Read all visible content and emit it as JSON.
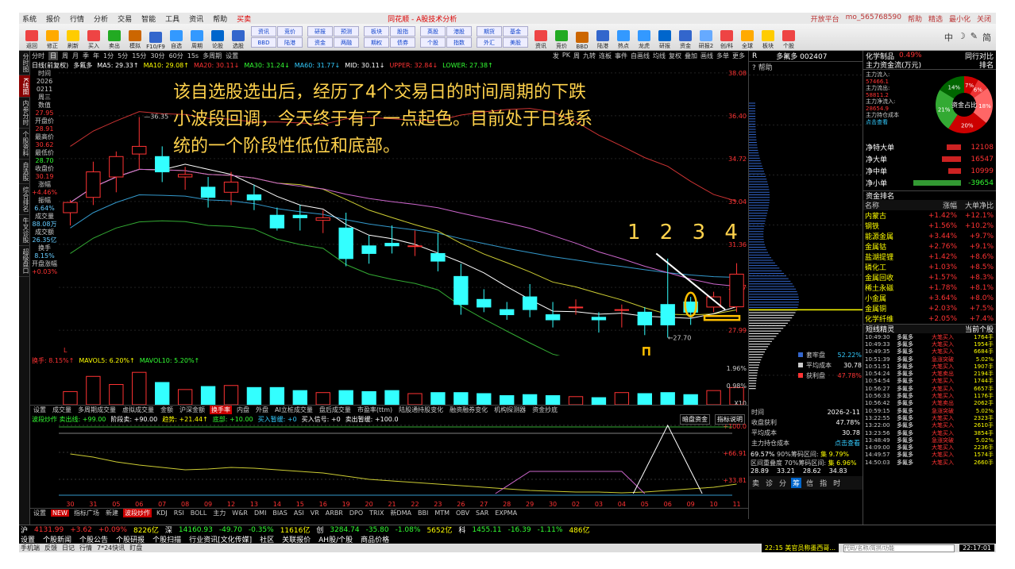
{
  "menubar": {
    "items": [
      "系统",
      "报价",
      "行情",
      "分析",
      "交易",
      "智能",
      "工具",
      "资讯",
      "帮助",
      "买卖"
    ],
    "center": "同花顺 - A股技术分析",
    "right": [
      "开放平台",
      "mo_565768590",
      "帮助",
      "精选",
      "最小化",
      "关闭"
    ]
  },
  "toolbar": {
    "buttons": [
      "返回",
      "修正",
      "刷新",
      "买入",
      "卖出",
      "模拟",
      "F10/F9",
      "自选",
      "周期",
      "论股",
      "选股",
      "资讯",
      "竞价",
      "BBD",
      "陆港",
      "热点",
      "龙虎",
      "研报",
      "资金",
      "研报2",
      "创/科",
      "全球",
      "板块",
      "个股",
      "股指",
      "指数",
      "期权",
      "期货",
      "债券",
      "基金",
      "英股",
      "外汇",
      "港股",
      "美股",
      "自定",
      "步窗",
      "默认"
    ],
    "smalls": [
      "资讯",
      "竞价",
      "BBD",
      "陆港",
      "研报",
      "预测",
      "资金",
      "两融",
      "板块",
      "股指",
      "期权",
      "债券",
      "英股",
      "港股",
      "个股",
      "指数",
      "期货",
      "基金",
      "外汇",
      "美股"
    ],
    "right": [
      "中",
      "☽",
      "✎",
      "简"
    ]
  },
  "lefttabs": [
    "分时图",
    "K线图",
    "内参分时",
    "个股资料",
    "自选股",
    "综合排名",
    "牛叉诊股",
    "超级盘口"
  ],
  "period": {
    "items": [
      "分时",
      "日",
      "周",
      "月",
      "季",
      "年",
      "1分",
      "5分",
      "15分",
      "30分",
      "60分",
      "15s",
      "多周期",
      "设置"
    ],
    "active": "日",
    "right": [
      "发",
      "PK",
      "周",
      "九转",
      "连板",
      "事件",
      "自画线",
      "均线",
      "复权",
      "叠加",
      "画线",
      "多单",
      "更多"
    ]
  },
  "info": {
    "stock": "多氟多",
    "items": [
      {
        "t": "日线(前复权)",
        "c": "w"
      },
      {
        "t": "MA5: 29.33↑",
        "c": "w"
      },
      {
        "t": "MA10: 29.08↑",
        "c": "y"
      },
      {
        "t": "MA20: 30.11↓",
        "c": "r"
      },
      {
        "t": "MA30: 31.24↓",
        "c": "g"
      },
      {
        "t": "MA60: 31.77↓",
        "c": "cy"
      },
      {
        "t": "MID: 30.11↓",
        "c": "w"
      },
      {
        "t": "UPPER: 32.84↓",
        "c": "r"
      },
      {
        "t": "LOWER: 27.38↑",
        "c": "g"
      }
    ]
  },
  "leftdata": [
    {
      "k": "时间",
      "v": "",
      "c": ""
    },
    {
      "k": "2026",
      "v": "",
      "c": ""
    },
    {
      "k": "0211",
      "v": "",
      "c": ""
    },
    {
      "k": "周三",
      "v": "",
      "c": ""
    },
    {
      "k": "数值",
      "v": "27.95",
      "c": "v"
    },
    {
      "k": "开盘价",
      "v": "28.91",
      "c": "v"
    },
    {
      "k": "最高价",
      "v": "30.62",
      "c": "v"
    },
    {
      "k": "最低价",
      "v": "28.70",
      "c": "g"
    },
    {
      "k": "收盘价",
      "v": "30.19",
      "c": "v"
    },
    {
      "k": "涨幅",
      "v": "+4.46%",
      "c": "v"
    },
    {
      "k": "振幅",
      "v": "6.64%",
      "c": "c"
    },
    {
      "k": "成交量",
      "v": "88.08万",
      "c": "c"
    },
    {
      "k": "成交额",
      "v": "26.35亿",
      "c": "c"
    },
    {
      "k": "换手",
      "v": "8.15%",
      "c": "c"
    },
    {
      "k": "开盘涨幅",
      "v": "+0.03%",
      "c": "v"
    }
  ],
  "annotation": "该自选股选出后，经历了4个交易日的时间周期的下跌小波段回调，今天终于有了一点起色。目前处于日线系统的一个阶段性低位和底部。",
  "numbers": "1 2 3 4",
  "chart_data": {
    "type": "candlestick",
    "x": [
      "30",
      "31",
      "05",
      "06",
      "07",
      "08",
      "09",
      "12",
      "13",
      "14",
      "15",
      "16",
      "19",
      "20",
      "21",
      "22",
      "23",
      "26",
      "27",
      "28",
      "29",
      "30",
      "02",
      "03",
      "04",
      "05",
      "06",
      "09",
      "10",
      "11"
    ],
    "ohlc": [
      [
        32.6,
        33.1,
        32.1,
        33.0
      ],
      [
        33.2,
        34.6,
        32.9,
        34.2
      ],
      [
        34.0,
        35.0,
        33.4,
        34.8
      ],
      [
        34.9,
        36.35,
        34.3,
        35.2
      ],
      [
        34.8,
        35.2,
        33.8,
        34.2
      ],
      [
        34.0,
        34.4,
        33.5,
        34.1
      ],
      [
        33.6,
        34.0,
        32.8,
        33.2
      ],
      [
        33.4,
        34.2,
        32.9,
        33.8
      ],
      [
        33.3,
        33.7,
        32.7,
        33.1
      ],
      [
        32.5,
        32.8,
        31.9,
        32.0
      ],
      [
        32.5,
        32.9,
        31.9,
        32.4
      ],
      [
        32.3,
        32.7,
        31.8,
        32.4
      ],
      [
        32.0,
        32.6,
        30.5,
        30.8
      ],
      [
        31.3,
        31.7,
        30.6,
        31.0
      ],
      [
        31.4,
        32.1,
        31.0,
        31.3
      ],
      [
        31.3,
        31.9,
        30.9,
        31.3
      ],
      [
        31.0,
        31.8,
        30.3,
        30.7
      ],
      [
        30.1,
        30.6,
        28.6,
        29.0
      ],
      [
        29.2,
        29.6,
        28.7,
        28.9
      ],
      [
        28.8,
        29.1,
        28.4,
        28.6
      ],
      [
        29.3,
        29.8,
        28.5,
        28.8
      ],
      [
        28.6,
        29.1,
        28.1,
        28.4
      ],
      [
        28.9,
        29.2,
        28.6,
        28.9
      ],
      [
        28.5,
        28.7,
        27.9,
        28.4
      ],
      [
        28.8,
        29.0,
        28.1,
        28.8
      ],
      [
        28.7,
        28.9,
        27.8,
        28.2
      ],
      [
        29.0,
        30.8,
        27.7,
        28.2
      ],
      [
        29.1,
        29.3,
        28.2,
        28.7
      ],
      [
        28.9,
        29.5,
        28.7,
        29.3
      ],
      [
        28.91,
        30.62,
        28.7,
        30.19
      ]
    ],
    "ylim": [
      27.0,
      38.2
    ],
    "yticks": [
      "38.08",
      "36.40",
      "34.72",
      "33.04",
      "31.36",
      "29.67",
      "27.99"
    ],
    "annotations": [
      "36.35",
      "27.70"
    ],
    "volume": [
      0.65,
      1.4,
      1.0,
      1.6,
      1.1,
      0.75,
      0.9,
      0.95,
      0.85,
      0.85,
      0.7,
      0.6,
      0.7,
      0.65,
      0.7,
      0.55,
      0.6,
      0.6,
      0.55,
      0.45,
      0.5,
      0.45,
      0.4,
      0.35,
      0.6,
      0.55,
      0.6,
      0.5,
      0.7,
      0.85
    ],
    "volticks": [
      "1.96%",
      "0.98%",
      "X10"
    ],
    "osc_ticks": [
      "+100.0",
      "+66.91",
      "+33.81"
    ]
  },
  "volinfo": [
    {
      "t": "换手: 8.15%↑",
      "c": "r"
    },
    {
      "t": "MAVOL5: 6.20%↑",
      "c": "y"
    },
    {
      "t": "MAVOL10: 5.20%↑",
      "c": "g"
    }
  ],
  "indtabs": [
    "设置",
    "成交量",
    "多周期成交量",
    "虚拟成交量",
    "金额",
    "沪深金额",
    "换手率",
    "内盘",
    "外盘",
    "AI立桩成交量",
    "盘后成交量",
    "市盈率(ttm)",
    "陆股通持股变化",
    "融资融券变化",
    "机构探测器",
    "资金抄底"
  ],
  "indactive": "换手率",
  "oscinfo": [
    {
      "t": "波段炒作 卖出线: +99.00",
      "c": "g"
    },
    {
      "t": "阶段卖: +90.00",
      "c": "w"
    },
    {
      "t": "趋势: +21.44↑",
      "c": "y"
    },
    {
      "t": "底部: +10.00",
      "c": "g"
    },
    {
      "t": "买入暂缓: +0",
      "c": "cy"
    },
    {
      "t": "买入信号: +0",
      "c": "w"
    },
    {
      "t": "卖出暂缓: +100.0",
      "c": "w"
    }
  ],
  "oscright": [
    "暗盘资金",
    "指标说明"
  ],
  "indtabs2": [
    "设置",
    "NEW",
    "指标广场",
    "新建",
    "波段炒作",
    "KDJ",
    "RSI",
    "BOLL",
    "主力",
    "W&R",
    "DMI",
    "BIAS",
    "ASI",
    "VR",
    "ARBR",
    "DPO",
    "TRIX",
    "新DMA",
    "BBI",
    "MTM",
    "OBV",
    "SAR",
    "EXPMA"
  ],
  "ind2active": "波段炒作",
  "mid": {
    "tabs": [
      "R",
      "多氟多 002407"
    ],
    "help": "帮助",
    "priceticks": [
      "38.08",
      "36.40",
      "34.72",
      "33.04",
      "31.36",
      "29.67",
      "27.99"
    ],
    "legend": [
      {
        "t": "套牢盘",
        "v": "52.22%",
        "c": "cy"
      },
      {
        "t": "平均成本",
        "v": "30.78",
        "c": "w"
      },
      {
        "t": "获利盘",
        "v": "47.78%",
        "c": "r"
      }
    ],
    "rows": [
      {
        "k": "时间",
        "v": "2026-2-11"
      },
      {
        "k": "收盘获利",
        "v": "47.78%"
      },
      {
        "k": "平均成本",
        "v": "30.78"
      },
      {
        "k": "主力持仓成本",
        "v": "点击查看"
      }
    ],
    "bottom": [
      "69.57%",
      "90%筹码区间:",
      "集 9.79%",
      "区间重叠度",
      "70%筹码区间:",
      "集 6.96%"
    ],
    "bottomnums": [
      "28.89",
      "33.21",
      "28.62",
      "34.83"
    ],
    "tabs2": [
      "卖",
      "诊",
      "分",
      "筹",
      "信",
      "指",
      "时"
    ]
  },
  "right": {
    "title": "化学制品",
    "pct": "0.49%",
    "title2": "同行对比",
    "flowtitle": "主力资金流(万元)",
    "rank": "排名",
    "pie": [
      "7%",
      "6%",
      "18%",
      "20%",
      "21%",
      "14%"
    ],
    "pielabel": "资金占比",
    "flow": [
      {
        "k": "主力流入:",
        "v": "57466.1"
      },
      {
        "k": "主力流出:",
        "v": "58811.2"
      },
      {
        "k": "主力净流入:",
        "v": "28654.9"
      },
      {
        "k": "主力持仓成本",
        "v": "点击查看"
      }
    ],
    "net": [
      {
        "k": "净特大单",
        "v": "12108",
        "c": "r",
        "w": 18
      },
      {
        "k": "净大单",
        "v": "16547",
        "c": "r",
        "w": 24
      },
      {
        "k": "净中单",
        "v": "10999",
        "c": "r",
        "w": 16
      },
      {
        "k": "净小单",
        "v": "-39654",
        "c": "g",
        "w": 60
      }
    ],
    "ranktitle": "资金排名",
    "rankhead": [
      "名称",
      "涨幅",
      "大单净比"
    ],
    "ranks": [
      {
        "n": "内蒙古",
        "a": "+1.42%",
        "b": "+12.1%"
      },
      {
        "n": "钢铁",
        "a": "+1.56%",
        "b": "+10.2%"
      },
      {
        "n": "能源金属",
        "a": "+3.44%",
        "b": "+9.7%"
      },
      {
        "n": "金属钴",
        "a": "+2.76%",
        "b": "+9.1%"
      },
      {
        "n": "盐湖提锂",
        "a": "+1.42%",
        "b": "+8.6%"
      },
      {
        "n": "磷化工",
        "a": "+1.03%",
        "b": "+8.5%"
      },
      {
        "n": "金属回收",
        "a": "+1.57%",
        "b": "+8.3%"
      },
      {
        "n": "稀土永磁",
        "a": "+1.78%",
        "b": "+8.1%"
      },
      {
        "n": "小金属",
        "a": "+3.64%",
        "b": "+8.0%"
      },
      {
        "n": "金属铜",
        "a": "+2.03%",
        "b": "+7.5%"
      },
      {
        "n": "化学纤维",
        "a": "+2.05%",
        "b": "+7.4%"
      }
    ],
    "tracktitle": "短线精灵",
    "track2": "当前个股",
    "trades": [
      [
        "10:49:30",
        "多氟多",
        "大笔买入",
        "1764手"
      ],
      [
        "10:49:33",
        "多氟多",
        "大笔买入",
        "1954手"
      ],
      [
        "10:49:35",
        "多氟多",
        "大笔买入",
        "6684手"
      ],
      [
        "10:51:39",
        "多氟多",
        "急涨突破",
        "5.02%"
      ],
      [
        "10:51:51",
        "多氟多",
        "大笔买入",
        "1907手"
      ],
      [
        "10:54:24",
        "多氟多",
        "大笔卖出",
        "2194手"
      ],
      [
        "10:54:54",
        "多氟多",
        "大笔买入",
        "1744手"
      ],
      [
        "10:56:27",
        "多氟多",
        "大笔买入",
        "6657手"
      ],
      [
        "10:56:33",
        "多氟多",
        "大笔买入",
        "1176手"
      ],
      [
        "10:56:42",
        "多氟多",
        "大笔卖出",
        "2062手"
      ],
      [
        "10:59:15",
        "多氟多",
        "急涨突破",
        "5.02%"
      ],
      [
        "13:22:55",
        "多氟多",
        "大笔买入",
        "2323手"
      ],
      [
        "13:22:00",
        "多氟多",
        "大笔买入",
        "2610手"
      ],
      [
        "13:23:56",
        "多氟多",
        "大笔买入",
        "3854手"
      ],
      [
        "13:48:49",
        "多氟多",
        "急涨突破",
        "5.02%"
      ],
      [
        "14:09:00",
        "多氟多",
        "大笔买入",
        "2236手"
      ],
      [
        "14:49:57",
        "多氟多",
        "大笔买入",
        "1574手"
      ],
      [
        "14:50:03",
        "多氟多",
        "大笔买入",
        "2660手"
      ]
    ]
  },
  "status": [
    {
      "t": "沪",
      "c": "w"
    },
    {
      "t": "4131.99",
      "c": "r"
    },
    {
      "t": "+3.62",
      "c": "r"
    },
    {
      "t": "+0.09%",
      "c": "r"
    },
    {
      "t": "8226亿",
      "c": "y"
    },
    {
      "t": "深",
      "c": "w"
    },
    {
      "t": "14160.93",
      "c": "g"
    },
    {
      "t": "-49.70",
      "c": "g"
    },
    {
      "t": "-0.35%",
      "c": "g"
    },
    {
      "t": "11616亿",
      "c": "y"
    },
    {
      "t": "创",
      "c": "w"
    },
    {
      "t": "3284.74",
      "c": "g"
    },
    {
      "t": "-35.80",
      "c": "g"
    },
    {
      "t": "-1.08%",
      "c": "g"
    },
    {
      "t": "5652亿",
      "c": "y"
    },
    {
      "t": "科",
      "c": "w"
    },
    {
      "t": "1455.11",
      "c": "g"
    },
    {
      "t": "-16.39",
      "c": "g"
    },
    {
      "t": "-1.11%",
      "c": "g"
    },
    {
      "t": "486亿",
      "c": "y"
    }
  ],
  "tabs3": [
    "设置",
    "个股新闻",
    "个股公告",
    "个股研报",
    "个股扫描",
    "行业资讯[文化传媒]",
    "社区",
    "关联报价",
    "AH股/个股",
    "商品价格"
  ],
  "status3": [
    "手机端",
    "反馈",
    "日记",
    "行情",
    "7*24快讯",
    "盯盘"
  ],
  "news": "22:15 美官员称墨西哥...",
  "searchph": "代码/名称/简拼/功能",
  "clock": "22:17:01"
}
